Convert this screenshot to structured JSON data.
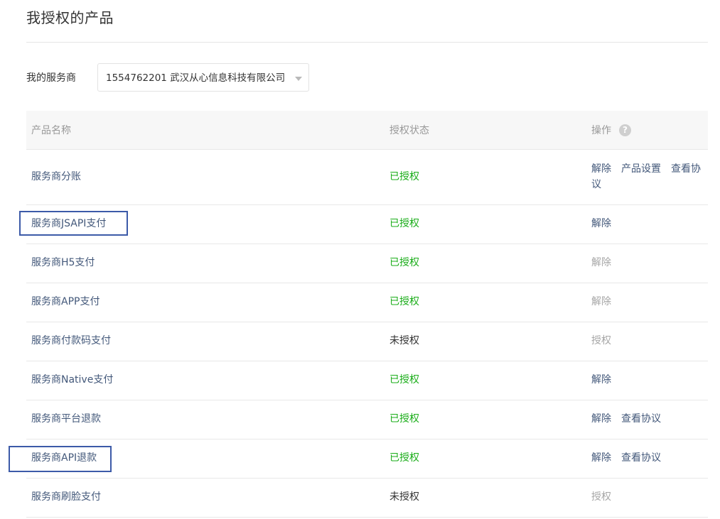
{
  "page": {
    "title": "我授权的产品"
  },
  "service_provider": {
    "label": "我的服务商",
    "selected": "1554762201 武汉从心信息科技有限公司"
  },
  "table": {
    "headers": {
      "name": "产品名称",
      "status": "授权状态",
      "ops": "操作",
      "help_icon": "?"
    },
    "rows": [
      {
        "name": "服务商分账",
        "status": "已授权",
        "ops": [
          {
            "label": "解除",
            "enabled": true
          },
          {
            "label": "产品设置",
            "enabled": true
          },
          {
            "label": "查看协议",
            "enabled": true
          }
        ]
      },
      {
        "name": "服务商JSAPI支付",
        "status": "已授权",
        "ops": [
          {
            "label": "解除",
            "enabled": true
          }
        ]
      },
      {
        "name": "服务商H5支付",
        "status": "已授权",
        "ops": [
          {
            "label": "解除",
            "enabled": false
          }
        ]
      },
      {
        "name": "服务商APP支付",
        "status": "已授权",
        "ops": [
          {
            "label": "解除",
            "enabled": false
          }
        ]
      },
      {
        "name": "服务商付款码支付",
        "status": "未授权",
        "ops": [
          {
            "label": "授权",
            "enabled": false
          }
        ]
      },
      {
        "name": "服务商Native支付",
        "status": "已授权",
        "ops": [
          {
            "label": "解除",
            "enabled": true
          }
        ]
      },
      {
        "name": "服务商平台退款",
        "status": "已授权",
        "ops": [
          {
            "label": "解除",
            "enabled": true
          },
          {
            "label": "查看协议",
            "enabled": true
          }
        ]
      },
      {
        "name": "服务商API退款",
        "status": "已授权",
        "ops": [
          {
            "label": "解除",
            "enabled": true
          },
          {
            "label": "查看协议",
            "enabled": true
          }
        ]
      },
      {
        "name": "服务商刷脸支付",
        "status": "未授权",
        "ops": [
          {
            "label": "授权",
            "enabled": false
          }
        ]
      }
    ]
  },
  "colors": {
    "authorized": "#1aad19",
    "link": "#43587a",
    "disabled": "#a6a6a6",
    "highlight_box": "#3c5aa8"
  }
}
